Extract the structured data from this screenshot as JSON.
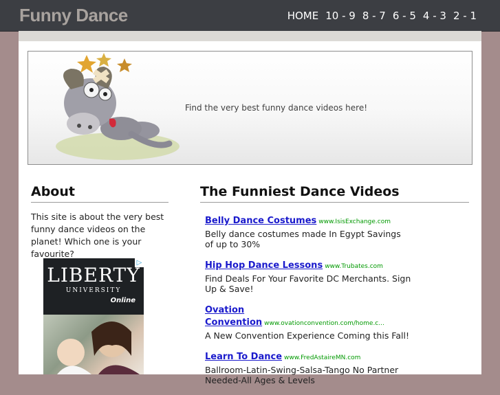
{
  "header": {
    "logo": "Funny Dance",
    "nav": [
      "HOME",
      "10 - 9",
      "8 - 7",
      "6 - 5",
      "4 - 3",
      "2 - 1"
    ]
  },
  "banner": {
    "tagline": "Find the very best funny dance videos here!"
  },
  "about": {
    "heading": "About",
    "text": "This site is about the very best funny dance videos on the planet! Which one is your favourite?"
  },
  "side_ad": {
    "logo": "LIBERTY",
    "sub": "UNIVERSITY",
    "online": "Online"
  },
  "videos": {
    "heading": "The Funniest Dance Videos",
    "ads": [
      {
        "title": "Belly Dance Costumes",
        "url": "www.IsisExchange.com",
        "desc": "Belly dance costumes made In Egypt Savings of up to 30%"
      },
      {
        "title": "Hip Hop Dance Lessons",
        "url": "www.Trubates.com",
        "desc": "Find Deals For Your Favorite DC Merchants. Sign Up & Save!"
      },
      {
        "title": "Ovation Convention",
        "url": "www.ovationconvention.com/home.c...",
        "desc": "A New Convention Experience Coming this Fall!"
      },
      {
        "title": "Learn To Dance",
        "url": "www.FredAstaireMN.com",
        "desc": "Ballroom-Latin-Swing-Salsa-Tango No Partner Needed-All Ages & Levels"
      }
    ]
  },
  "colors": {
    "topbar": "#3c3e43",
    "page_bg": "#a48c8c",
    "link": "#1a1acc",
    "ad_url": "#009900"
  }
}
